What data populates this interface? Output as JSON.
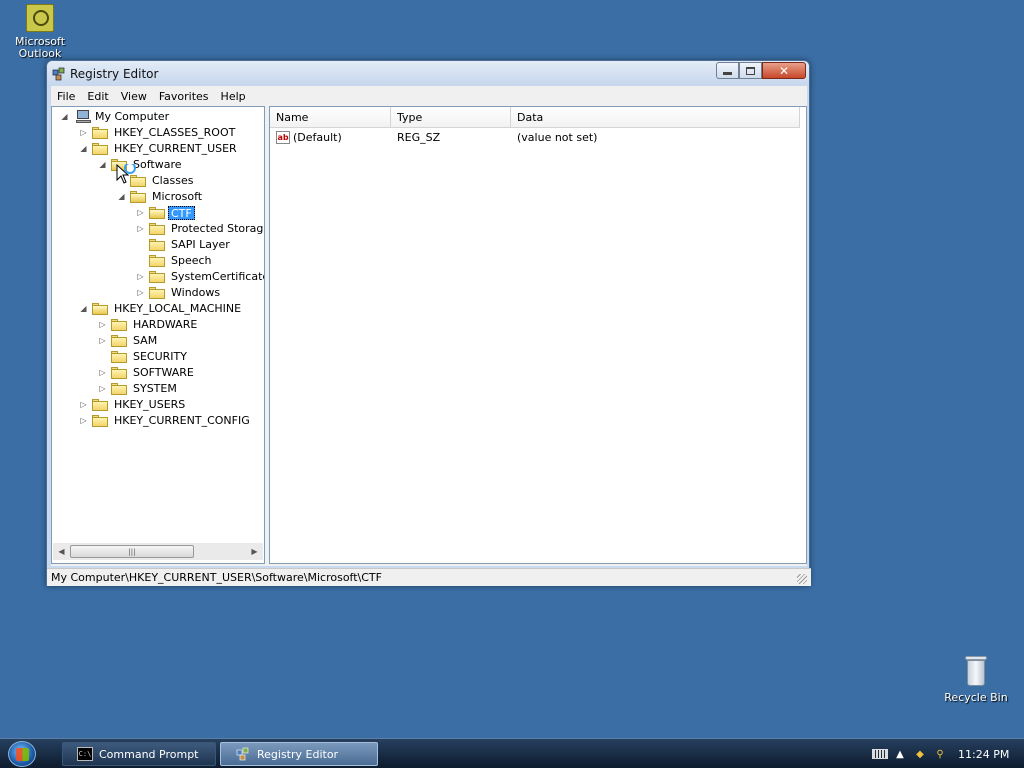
{
  "desktop": {
    "icons": [
      {
        "label": "Microsoft Outlook"
      },
      {
        "label": "Recycle Bin"
      }
    ]
  },
  "window": {
    "title": "Registry Editor",
    "menu": [
      "File",
      "Edit",
      "View",
      "Favorites",
      "Help"
    ],
    "close_glyph": "✕",
    "tree": {
      "root": "My Computer",
      "nodes": {
        "hkcr": "HKEY_CLASSES_ROOT",
        "hkcu": "HKEY_CURRENT_USER",
        "software": "Software",
        "classes": "Classes",
        "microsoft": "Microsoft",
        "ctf": "CTF",
        "protected_storage": "Protected Storage",
        "sapi_layer": "SAPI Layer",
        "speech": "Speech",
        "system_certificates": "SystemCertificates",
        "windows": "Windows",
        "hklm": "HKEY_LOCAL_MACHINE",
        "hardware": "HARDWARE",
        "sam": "SAM",
        "security": "SECURITY",
        "software_lm": "SOFTWARE",
        "system": "SYSTEM",
        "hku": "HKEY_USERS",
        "hkcc": "HKEY_CURRENT_CONFIG"
      },
      "selected": "CTF"
    },
    "list": {
      "columns": [
        "Name",
        "Type",
        "Data"
      ],
      "rows": [
        {
          "name": "(Default)",
          "type": "REG_SZ",
          "data": "(value not set)"
        }
      ]
    },
    "status": "My Computer\\HKEY_CURRENT_USER\\Software\\Microsoft\\CTF"
  },
  "taskbar": {
    "buttons": [
      {
        "label": "Command Prompt",
        "icon": "command-prompt-icon",
        "active": false
      },
      {
        "label": "Registry Editor",
        "icon": "registry-editor-icon",
        "active": true
      }
    ],
    "clock": "11:24 PM"
  },
  "colors": {
    "desktop": "#3a6ea5",
    "selection": "#3399ff",
    "taskbar": "#1a2c44"
  }
}
